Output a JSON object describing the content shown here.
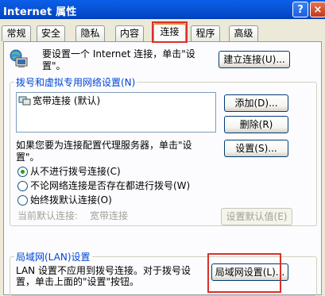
{
  "window": {
    "title": "Internet 属性",
    "help_button": "?",
    "close_button": "×"
  },
  "tabs": [
    {
      "label": "常规"
    },
    {
      "label": "安全"
    },
    {
      "label": "隐私"
    },
    {
      "label": "内容"
    },
    {
      "label": "连接"
    },
    {
      "label": "程序"
    },
    {
      "label": "高级"
    }
  ],
  "active_tab": "连接",
  "setup": {
    "text_line1": "要设置一个 Internet 连接，单击\"设",
    "text_line2": "置\"。",
    "button": "建立连接(U)..."
  },
  "dialup": {
    "group_label": "拨号和虚拟专用网络设置(N)",
    "connections": [
      "宽带连接 (默认)"
    ],
    "add_button": "添加(D)...",
    "delete_button": "删除(R)",
    "proxy_text_line1": "如果您要为连接配置代理服务器，单击\"设",
    "proxy_text_line2": "置\"。",
    "settings_button": "设置(S)...",
    "options": [
      {
        "label": "从不进行拨号连接(C)",
        "selected": true
      },
      {
        "label": "不论网络连接是否存在都进行拨号(W)",
        "selected": false
      },
      {
        "label": "始终拨默认连接(O)",
        "selected": false
      }
    ],
    "current_default_label": "当前默认连接:",
    "current_default_value": "宽带连接",
    "set_default_button": "设置默认值(E)"
  },
  "lan": {
    "group_label": "局域网(LAN)设置",
    "text_line1": "LAN 设置不应用到拨号连接。对于拨号设",
    "text_line2": "置，单击上面的\"设置\"按钮。",
    "button": "局域网设置(L)..."
  },
  "colors": {
    "title_bar": "#0A54D6",
    "group_label": "#0046D5",
    "highlight_box": "#D9302A",
    "dialog_bg": "#ECE9D8"
  }
}
